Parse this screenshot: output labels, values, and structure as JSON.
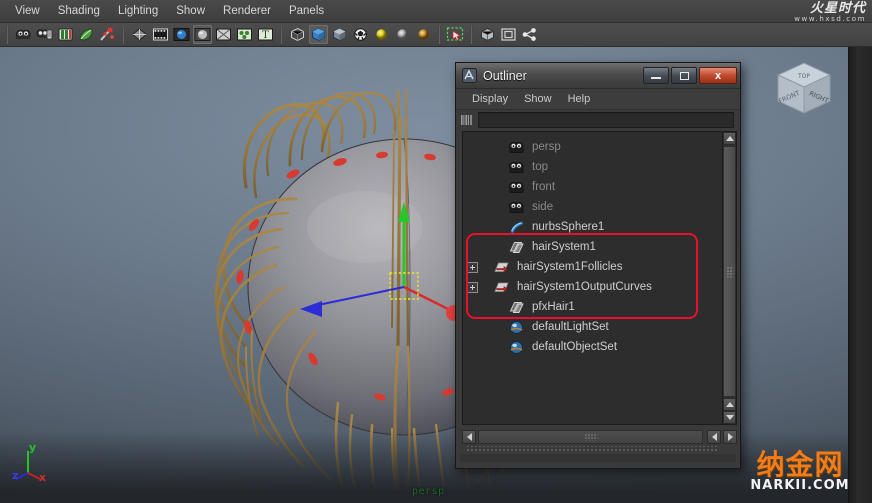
{
  "app": {
    "menubar": [
      {
        "label": "View",
        "name": "menu-view"
      },
      {
        "label": "Shading",
        "name": "menu-shading"
      },
      {
        "label": "Lighting",
        "name": "menu-lighting"
      },
      {
        "label": "Show",
        "name": "menu-show"
      },
      {
        "label": "Renderer",
        "name": "menu-renderer"
      },
      {
        "label": "Panels",
        "name": "menu-panels"
      }
    ],
    "brand": {
      "name_cn": "火星时代",
      "url": "www.hxsd.com"
    }
  },
  "toolbar": {
    "icons": [
      "camera-icon",
      "camera-attributes-icon",
      "book-icon",
      "leaf-icon",
      "wand-icon",
      "wireframe-icon",
      "film-icon",
      "smooth-shade-icon",
      "flat-shade-icon",
      "texture-off-icon",
      "texture-on-icon",
      "text-icon",
      "xray-icon",
      "shaded-box-icon",
      "shaded-solid-icon",
      "checker-icon",
      "light-yellow-icon",
      "light-grey-icon",
      "light-brown-icon",
      "select-marquee-icon",
      "box-wire-icon",
      "frame-icon",
      "share-icon"
    ]
  },
  "viewport": {
    "camera_label": "persp",
    "axis_gizmo": {
      "x": "x",
      "y": "y",
      "z": "z"
    },
    "view_cube": {
      "top": "TOP",
      "front": "FRONT",
      "right": "RIGHT"
    },
    "watermark": {
      "cn": "纳金网",
      "en": "NARKII.COM"
    },
    "colors": {
      "bg_top": "#7e8ea0",
      "bg_bottom": "#3e4852",
      "sphere": "#8b8b90",
      "hair": "#9a7c41",
      "axis_x": "#d92b2b",
      "axis_y": "#2fd02f",
      "axis_z": "#2b2bd9",
      "selection": "#e8e82a"
    }
  },
  "outliner": {
    "title": "Outliner",
    "window_buttons": {
      "minimize": "–",
      "maximize": "❐",
      "close": "x"
    },
    "menus": [
      {
        "label": "Display",
        "name": "outliner-menu-display"
      },
      {
        "label": "Show",
        "name": "outliner-menu-show"
      },
      {
        "label": "Help",
        "name": "outliner-menu-help"
      }
    ],
    "search": {
      "value": "",
      "placeholder": ""
    },
    "highlight_color": "#e8102a",
    "items": [
      {
        "label": "persp",
        "icon": "camera-icon",
        "dim": true,
        "expand": false,
        "indent": 1
      },
      {
        "label": "top",
        "icon": "camera-icon",
        "dim": true,
        "expand": false,
        "indent": 1
      },
      {
        "label": "front",
        "icon": "camera-icon",
        "dim": true,
        "expand": false,
        "indent": 1
      },
      {
        "label": "side",
        "icon": "camera-icon",
        "dim": true,
        "expand": false,
        "indent": 1
      },
      {
        "label": "nurbsSphere1",
        "icon": "surface-icon",
        "dim": false,
        "expand": false,
        "indent": 1
      },
      {
        "label": "hairSystem1",
        "icon": "hair-icon",
        "dim": false,
        "expand": false,
        "indent": 1
      },
      {
        "label": "hairSystem1Follicles",
        "icon": "follicle-icon",
        "dim": false,
        "expand": true,
        "indent": 0
      },
      {
        "label": "hairSystem1OutputCurves",
        "icon": "follicle-icon",
        "dim": false,
        "expand": true,
        "indent": 0
      },
      {
        "label": "pfxHair1",
        "icon": "hair-icon",
        "dim": false,
        "expand": false,
        "indent": 1
      },
      {
        "label": "defaultLightSet",
        "icon": "set-icon",
        "dim": false,
        "expand": false,
        "indent": 1
      },
      {
        "label": "defaultObjectSet",
        "icon": "set-icon",
        "dim": false,
        "expand": false,
        "indent": 1
      }
    ]
  }
}
